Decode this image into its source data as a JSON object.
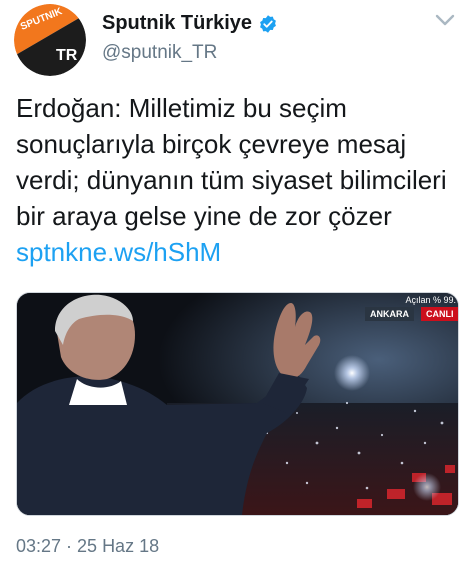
{
  "account": {
    "display_name": "Sputnik Türkiye",
    "handle": "@sputnik_TR",
    "avatar_logo_text": "SPUTNIK",
    "avatar_sub_text": "TR",
    "verified_icon": "verified-badge-icon"
  },
  "tweet": {
    "text": "Erdoğan: Milletimiz bu seçim sonuçlarıyla birçok çevreye mesaj verdi; dünyanın tüm siyaset bilimcileri bir araya gelse yine de zor çözer",
    "link": "sptnkne.ws/hShM",
    "timestamp": "03:27 · 25 Haz 18"
  },
  "media": {
    "top_overlay": "Açılan % 99.",
    "location_label": "ANKARA",
    "live_label": "CANLI"
  },
  "colors": {
    "link": "#1da1f2",
    "verified": "#1da1f2",
    "avatar_orange": "#f2771d",
    "live_red": "#cc0f1c"
  }
}
